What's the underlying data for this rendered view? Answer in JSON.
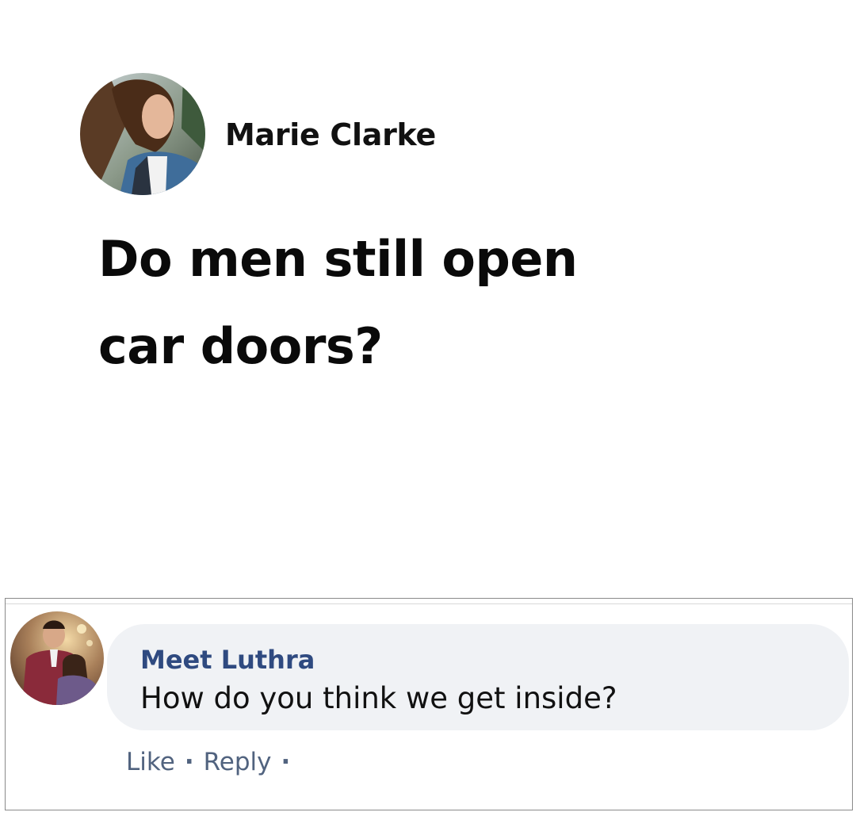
{
  "post": {
    "author": "Marie Clarke",
    "text_line1": "Do men still open",
    "text_line2": "car doors?"
  },
  "comment": {
    "author": "Meet Luthra",
    "text": "How do you think we get inside?",
    "actions": {
      "like": "Like",
      "reply": "Reply",
      "separator": "·"
    }
  },
  "colors": {
    "name_link": "#2f4a80",
    "action_link": "#51637f",
    "bubble_bg": "#f0f2f5"
  }
}
